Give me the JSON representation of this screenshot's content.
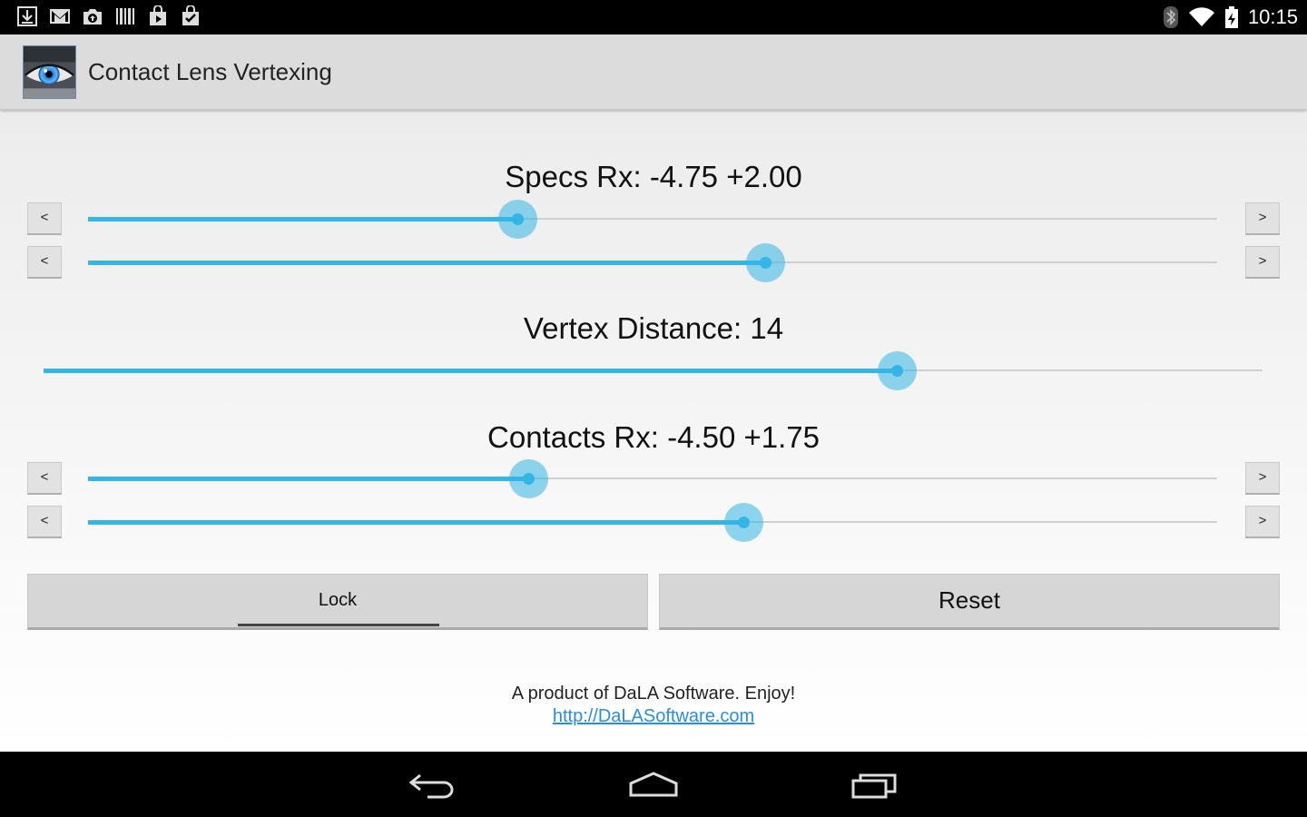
{
  "status_bar": {
    "time": "10:15",
    "notification_icons": [
      "download-icon",
      "gmail-icon",
      "camera-upload-icon",
      "barcode-icon",
      "play-store-icon",
      "shopping-check-icon"
    ],
    "system_icons": [
      "bluetooth-icon",
      "wifi-icon",
      "battery-icon"
    ]
  },
  "action_bar": {
    "title": "Contact Lens Vertexing",
    "icon": "eye-app-icon"
  },
  "specs": {
    "label": "Specs Rx: -4.75 +2.00",
    "sphere_slider_level": 0.38,
    "cylinder_slider_level": 0.6,
    "decrement_label": "<",
    "increment_label": ">"
  },
  "vertex": {
    "label": "Vertex Distance: 14",
    "slider_level": 0.7
  },
  "contacts": {
    "label": "Contacts Rx: -4.50 +1.75",
    "sphere_slider_level": 0.39,
    "cylinder_slider_level": 0.58,
    "decrement_label": "<",
    "increment_label": ">"
  },
  "buttons": {
    "lock_label": "Lock",
    "reset_label": "Reset"
  },
  "footer": {
    "text": "A product of DaLA Software.  Enjoy!",
    "link": "http://DaLASoftware.com"
  },
  "nav_bar": {
    "items": [
      "back-icon",
      "home-icon",
      "recents-icon"
    ]
  },
  "colors": {
    "accent": "#33b5e5",
    "status_bar": "#000000",
    "action_bar": "#dcdcdc",
    "link": "#2a8ee0"
  }
}
